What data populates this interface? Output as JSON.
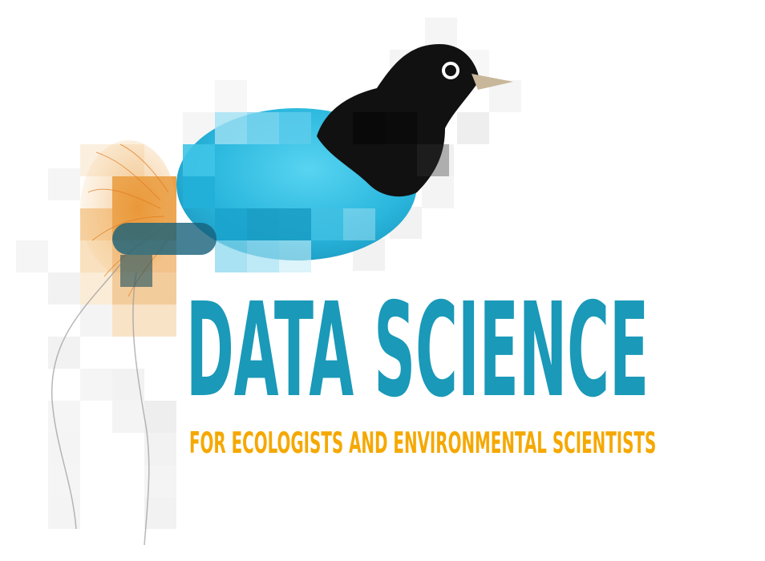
{
  "logo": {
    "title": "DATA SCIENCE",
    "subtitle": "FOR ECOLOGISTS AND ENVIRONMENTAL SCIENTISTS",
    "colors": {
      "title": "#1a99b8",
      "subtitle": "#f5a800",
      "bird_body": "#2bb8dd",
      "bird_head": "#111111",
      "beak": "#c8b79a",
      "plumes": "#e8902a",
      "pixel_grey": "#d9d9d9"
    },
    "icon": "bird-of-paradise-pixel-illustration"
  }
}
